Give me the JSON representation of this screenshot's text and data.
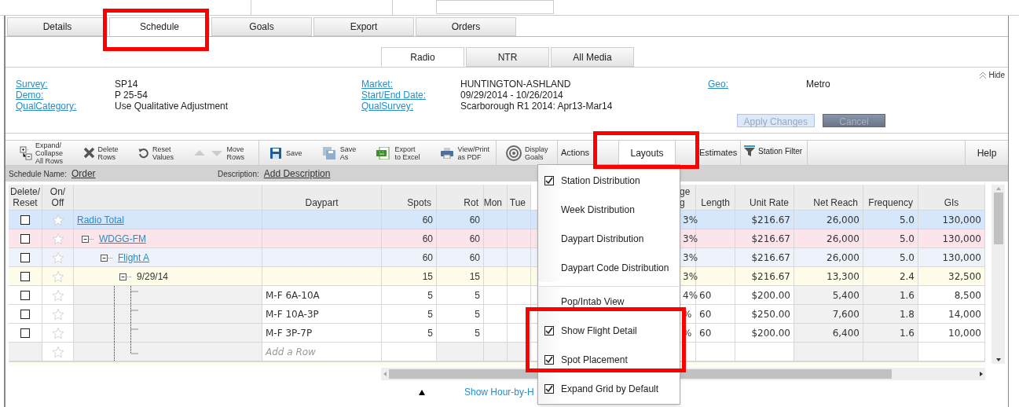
{
  "main_tabs": [
    {
      "label": "Details",
      "selected": false
    },
    {
      "label": "Schedule",
      "selected": true
    },
    {
      "label": "Goals",
      "selected": false
    },
    {
      "label": "Export",
      "selected": false
    },
    {
      "label": "Orders",
      "selected": false
    }
  ],
  "media_tabs": [
    {
      "label": "Radio",
      "selected": true
    },
    {
      "label": "NTR",
      "selected": false
    },
    {
      "label": "All Media",
      "selected": false
    }
  ],
  "hide_label": "Hide",
  "info": [
    [
      {
        "label": "Survey:",
        "value": "SP14"
      },
      {
        "label": "Demo:",
        "value": "P 25-54"
      },
      {
        "label": "QualCategory:",
        "value": "Use Qualitative Adjustment"
      }
    ],
    [
      {
        "label": "Market:",
        "value": "HUNTINGTON-ASHLAND"
      },
      {
        "label": "Start/End Date:",
        "value": "09/29/2014 - 10/26/2014"
      },
      {
        "label": "QualSurvey:",
        "value": "Scarborough R1 2014: Apr13-Mar14"
      }
    ],
    [
      {
        "label": "Geo:",
        "value": "Metro"
      }
    ]
  ],
  "apply_button": {
    "label": "Apply Changes",
    "disabled": true
  },
  "cancel_button": {
    "label": "Cancel",
    "disabled": true
  },
  "toolbar": [
    {
      "kind": "expand",
      "label": "Expand/\nCollapse\nAll Rows"
    },
    {
      "kind": "delete",
      "label": "Delete\nRows"
    },
    {
      "kind": "reset",
      "label": "Reset\nValues"
    },
    {
      "kind": "move",
      "label": "Move\nRows"
    },
    {
      "kind": "save",
      "label": "Save"
    },
    {
      "kind": "saveas",
      "label": "Save\nAs"
    },
    {
      "kind": "excel",
      "label": "Export\nto Excel"
    },
    {
      "kind": "pdf",
      "label": "View/Print\nas PDF"
    },
    {
      "kind": "goals",
      "label": "Display\nGoals"
    }
  ],
  "menu_tabs": [
    {
      "label": "Actions",
      "selected": false
    },
    {
      "label": "Layouts",
      "selected": true
    },
    {
      "label": "Estimates",
      "selected": false
    },
    {
      "label": "Station Filter",
      "selected": false,
      "kind": "filter"
    }
  ],
  "help_label": "Help",
  "schedule_name": {
    "label": "Schedule Name:",
    "value": "Order"
  },
  "description": {
    "label": "Description:",
    "value": "Add Description"
  },
  "columns": [
    "Delete/\nReset",
    "On/\nOff",
    "",
    "Daypart",
    "Spots",
    "Rot",
    "Mon",
    "Tue",
    "",
    "ge\ng",
    "Length",
    "Unit Rate",
    "Net Reach",
    "Frequency",
    "GIs"
  ],
  "rows": [
    {
      "kind": "total",
      "label": "Radio Total",
      "checked": false,
      "spots": "60",
      "rot": "60",
      "pct": "3%",
      "unit_rate": "$216.67",
      "net_reach": "26,000",
      "frequency": "5.0",
      "gis": "130,000",
      "children": [
        {
          "kind": "station",
          "label": "WDGG-FM",
          "checked": false,
          "spots": "60",
          "rot": "60",
          "pct": "3%",
          "unit_rate": "$216.67",
          "net_reach": "26,000",
          "frequency": "5.0",
          "gis": "130,000",
          "children": [
            {
              "kind": "flight",
              "label": "Flight A",
              "checked": false,
              "spots": "60",
              "rot": "60",
              "pct": "3%",
              "unit_rate": "$216.67",
              "net_reach": "26,000",
              "frequency": "5.0",
              "gis": "130,000",
              "children": [
                {
                  "kind": "week",
                  "label": "9/29/14",
                  "checked": false,
                  "spots": "15",
                  "rot": "15",
                  "pct": "3%",
                  "unit_rate": "$216.67",
                  "net_reach": "13,300",
                  "frequency": "2.4",
                  "gis": "32,500",
                  "children": [
                    {
                      "kind": "line",
                      "daypart": "M-F 6A-10A",
                      "checked": false,
                      "spots": "5",
                      "rot": "5",
                      "pct": "4%",
                      "length": "60",
                      "unit_rate": "$200.00",
                      "net_reach": "5,400",
                      "frequency": "1.6",
                      "gis": "8,500"
                    },
                    {
                      "kind": "line",
                      "daypart": "M-F 10A-3P",
                      "checked": false,
                      "spots": "5",
                      "rot": "5",
                      "pct": "%",
                      "length": "60",
                      "unit_rate": "$250.00",
                      "net_reach": "7,600",
                      "frequency": "1.8",
                      "gis": "14,000"
                    },
                    {
                      "kind": "line",
                      "daypart": "M-F 3P-7P",
                      "checked": false,
                      "spots": "5",
                      "rot": "5",
                      "pct": "%",
                      "length": "60",
                      "unit_rate": "$200.00",
                      "net_reach": "6,400",
                      "frequency": "1.6",
                      "gis": "10,000"
                    },
                    {
                      "kind": "add",
                      "daypart": "Add a Row"
                    }
                  ]
                }
              ]
            }
          ]
        }
      ]
    }
  ],
  "layouts_menu": [
    {
      "kind": "item",
      "label": "Station Distribution",
      "checked": true
    },
    {
      "kind": "item",
      "label": "Week Distribution",
      "checked": false
    },
    {
      "kind": "item",
      "label": "Daypart Distribution",
      "checked": false
    },
    {
      "kind": "item",
      "label": "Daypart Code Distribution",
      "checked": false
    },
    {
      "kind": "separator"
    },
    {
      "kind": "item",
      "label": "Pop/Intab View",
      "checked": false
    },
    {
      "kind": "item",
      "label": "Show Flight Detail",
      "checked": true
    },
    {
      "kind": "item",
      "label": "Spot Placement",
      "checked": true
    },
    {
      "kind": "item",
      "label": "Expand Grid by Default",
      "checked": true
    }
  ],
  "footer_link": "Show Hour-by-H"
}
